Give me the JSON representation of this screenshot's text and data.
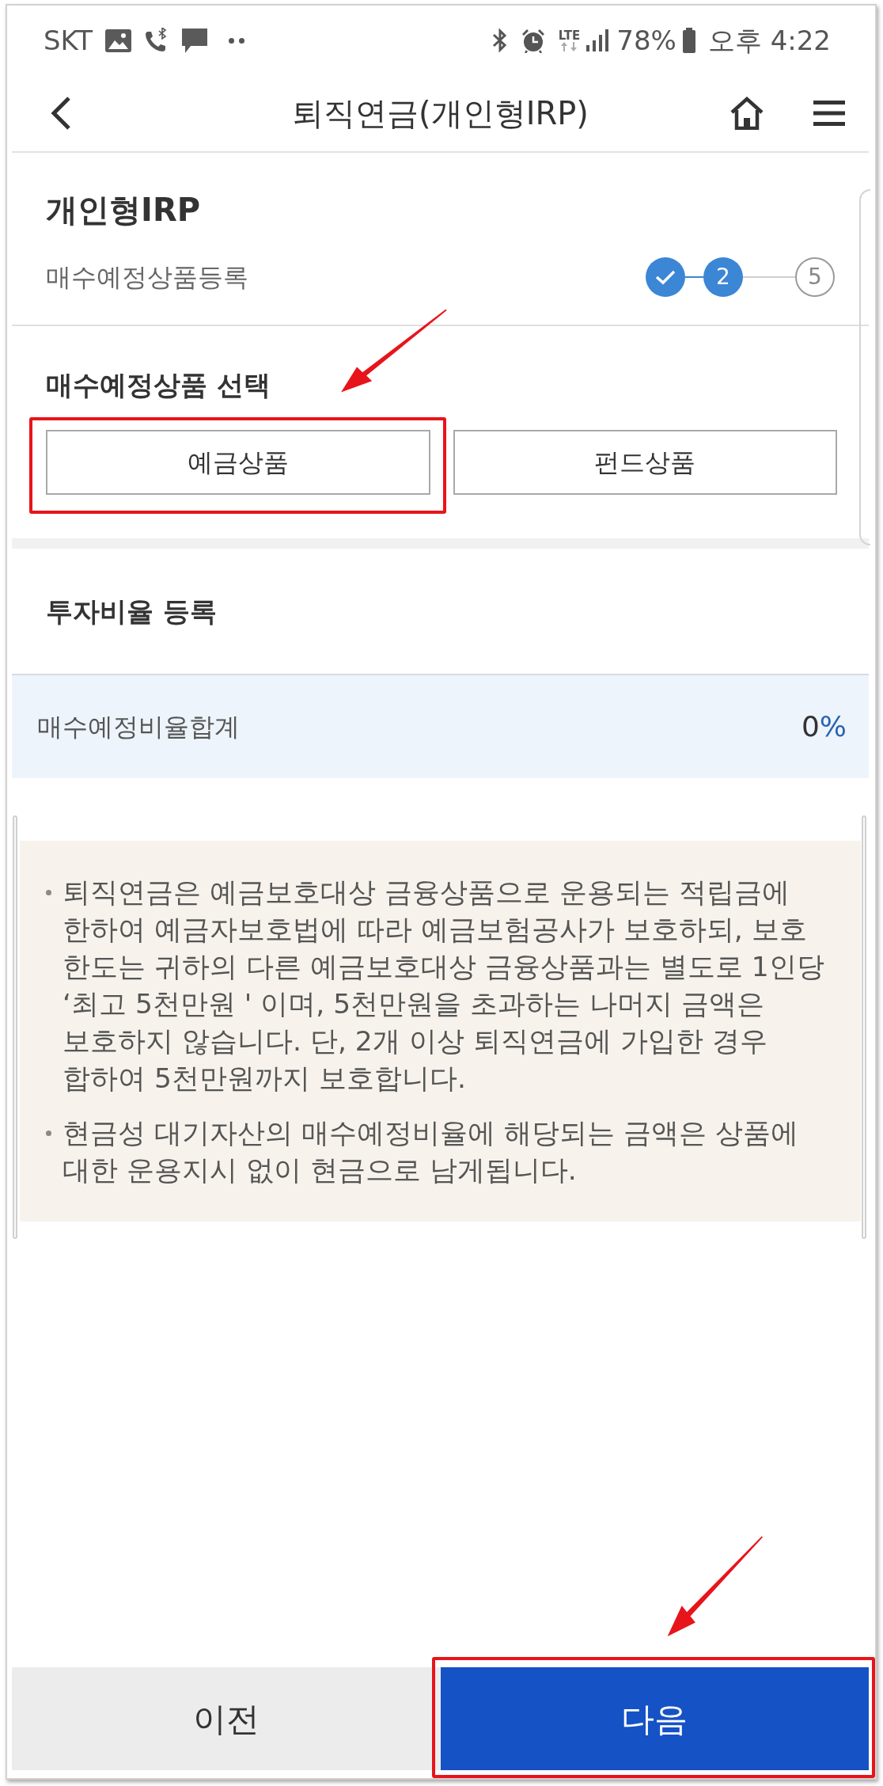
{
  "status_bar": {
    "carrier": "SKT",
    "network": "LTE",
    "battery": "78%",
    "time": "오후 4:22"
  },
  "header": {
    "title": "퇴직연금(개인형IRP)"
  },
  "page": {
    "title": "개인형IRP",
    "subtitle": "매수예정상품등록",
    "steps": [
      {
        "kind": "done"
      },
      {
        "label": "2",
        "kind": "current"
      },
      {
        "label": "5",
        "kind": "pending"
      }
    ]
  },
  "product_section": {
    "heading": "매수예정상품 선택",
    "options": [
      {
        "label": "예금상품",
        "highlighted": true
      },
      {
        "label": "펀드상품",
        "highlighted": false
      }
    ]
  },
  "ratio_section": {
    "heading": "투자비율 등록",
    "total_label": "매수예정비율합계",
    "total_value": "0",
    "total_unit": "%"
  },
  "notice": {
    "items": [
      "퇴직연금은 예금보호대상 금융상품으로 운용되는 적립금에 한하여 예금자보호법에 따라 예금보험공사가 보호하되, 보호 한도는 귀하의 다른 예금보호대상 금융상품과는 별도로 1인당 ‘최고 5천만원 ' 이며, 5천만원을 초과하는 나머지 금액은 보호하지 않습니다. 단, 2개 이상 퇴직연금에 가입한 경우 합하여 5천만원까지 보호합니다.",
      "현금성 대기자산의 매수예정비율에 해당되는 금액은 상품에 대한 운용지시 없이 현금으로 남게됩니다."
    ]
  },
  "footer_buttons": [
    {
      "label": "이전",
      "kind": "secondary",
      "highlighted": false
    },
    {
      "label": "다음",
      "kind": "primary",
      "highlighted": true
    }
  ]
}
